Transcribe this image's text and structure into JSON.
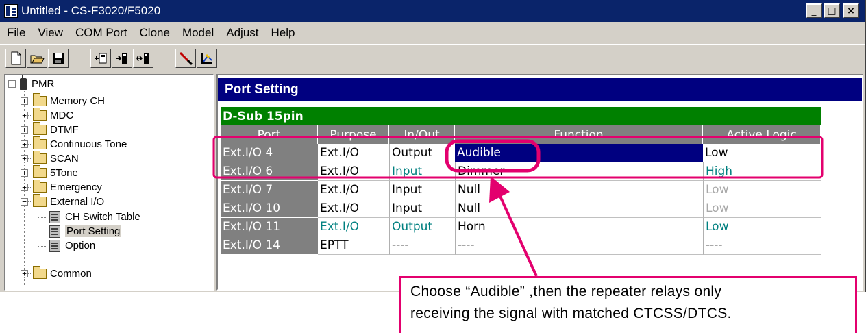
{
  "window": {
    "title": "Untitled - CS-F3020/F5020",
    "minimize": "_",
    "maximize": "□",
    "close": "×"
  },
  "menu": [
    "File",
    "View",
    "COM Port",
    "Clone",
    "Model",
    "Adjust",
    "Help"
  ],
  "toolbar_icons": [
    "new-file-icon",
    "open-folder-icon",
    "save-icon",
    "read-from-radio-icon",
    "write-to-radio-icon",
    "clone-icon",
    "cut-icon",
    "info-icon"
  ],
  "tree": {
    "root": "PMR",
    "items": [
      "Memory CH",
      "MDC",
      "DTMF",
      "Continuous Tone",
      "SCAN",
      "5Tone",
      "Emergency",
      "External I/O"
    ],
    "children": [
      "CH Switch Table",
      "Port Setting",
      "Option"
    ],
    "last": "Common",
    "selected": "Port Setting"
  },
  "panel": {
    "title": "Port Setting",
    "group": "D-Sub 15pin",
    "columns": [
      "Port",
      "Purpose",
      "In/Out",
      "Function",
      "Active Logic"
    ],
    "rows": [
      {
        "port": "Ext.I/O 4",
        "purpose": "Ext.I/O",
        "inout": "Output",
        "function": "Audible",
        "logic": "Low"
      },
      {
        "port": "Ext.I/O 6",
        "purpose": "Ext.I/O",
        "inout": "Input",
        "function": "Dimmer",
        "logic": "High"
      },
      {
        "port": "Ext.I/O 7",
        "purpose": "Ext.I/O",
        "inout": "Input",
        "function": "Null",
        "logic": "Low"
      },
      {
        "port": "Ext.I/O 10",
        "purpose": "Ext.I/O",
        "inout": "Input",
        "function": "Null",
        "logic": "Low"
      },
      {
        "port": "Ext.I/O 11",
        "purpose": "Ext.I/O",
        "inout": "Output",
        "function": "Horn",
        "logic": "Low"
      },
      {
        "port": "Ext.I/O 14",
        "purpose": "EPTT",
        "inout": "----",
        "function": "----",
        "logic": "----"
      }
    ]
  },
  "callout": {
    "line1": "Choose “Audible” ,then the repeater relays only",
    "line2": "receiving the signal with matched CTCSS/DTCS."
  },
  "colors": {
    "titlebar": "#0a246a",
    "panel_header": "#000080",
    "group_header": "#008000",
    "annotation": "#e3006e"
  }
}
